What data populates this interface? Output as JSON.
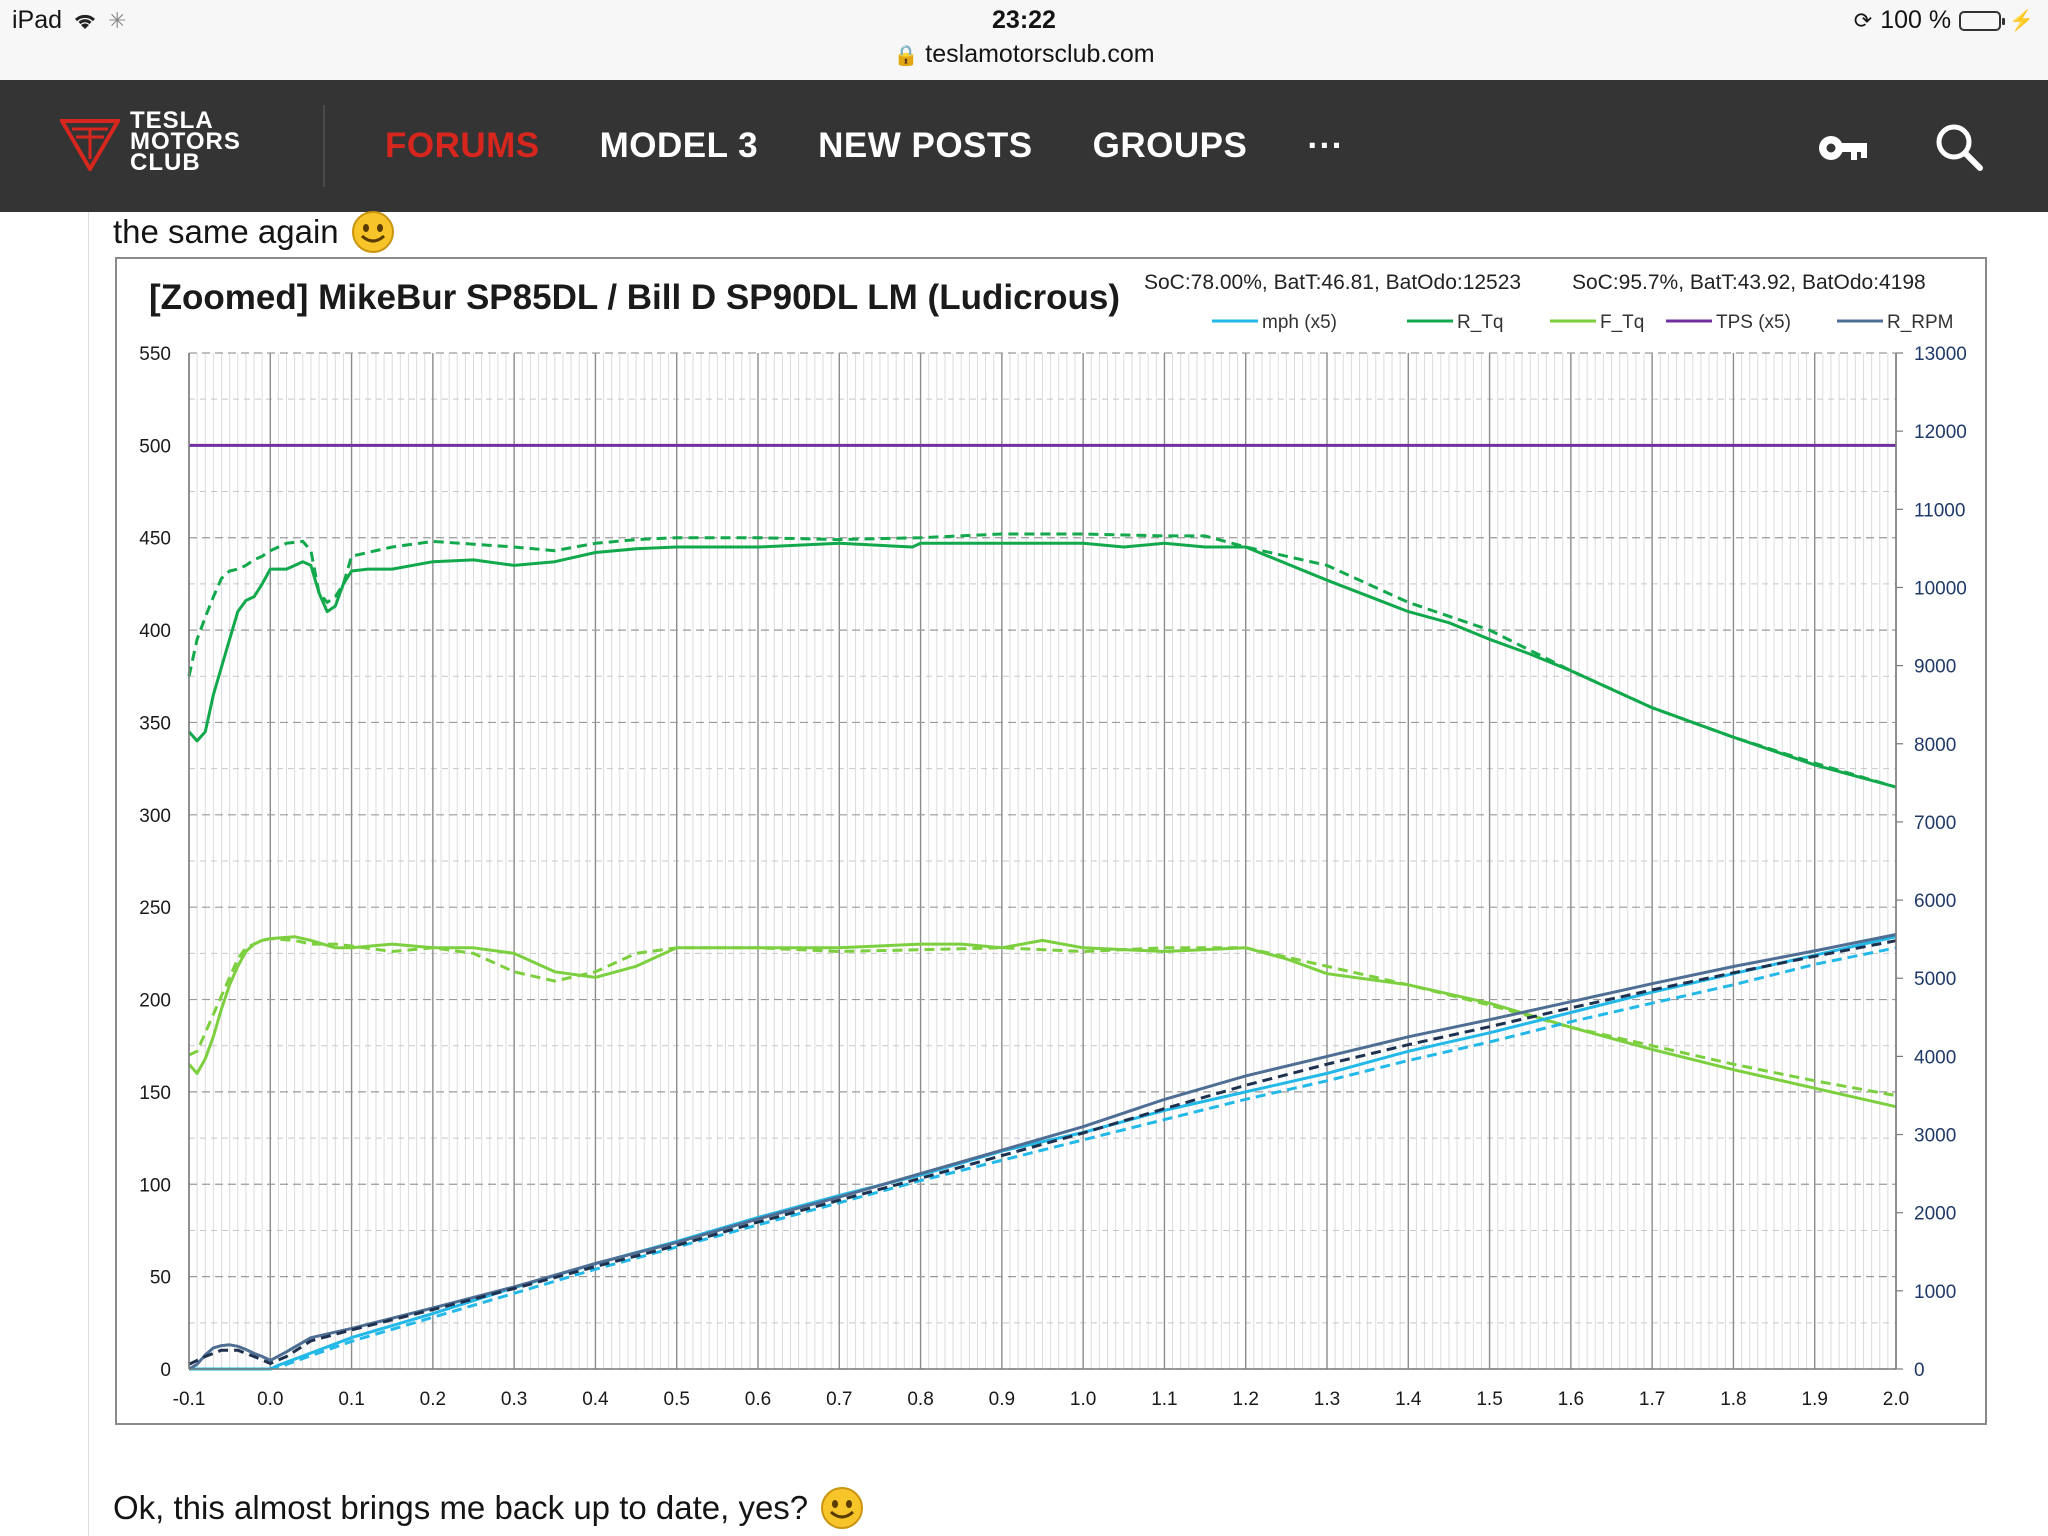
{
  "status_bar": {
    "device": "iPad",
    "time": "23:22",
    "url": "teslamotorsclub.com",
    "battery": "100 %"
  },
  "nav": {
    "logo_lines": [
      "TESLA",
      "MOTORS",
      "CLUB"
    ],
    "items": [
      {
        "label": "FORUMS",
        "active": true
      },
      {
        "label": "MODEL 3",
        "active": false
      },
      {
        "label": "NEW POSTS",
        "active": false
      },
      {
        "label": "GROUPS",
        "active": false
      },
      {
        "label": "···",
        "active": false
      }
    ],
    "accent_color": "#d7261e",
    "icons": [
      "key-icon",
      "search-icon"
    ]
  },
  "post": {
    "text_top": "the same again",
    "text_bottom": "Ok, this almost brings me back up to date, yes?",
    "emoji": "smiley-emoji"
  },
  "chart_data": {
    "type": "line",
    "title": "[Zoomed] MikeBur SP85DL / Bill D SP90DL LM (Ludicrous)",
    "subtitle_left": "SoC:78.00%, BatT:46.81, BatOdo:12523",
    "subtitle_right": "SoC:95.7%, BatT:43.92, BatOdo:4198",
    "xlim": [
      -0.1,
      2.0
    ],
    "x_ticks": [
      "-0.1",
      "0.0",
      "0.1",
      "0.2",
      "0.3",
      "0.4",
      "0.5",
      "0.6",
      "0.7",
      "0.8",
      "0.9",
      "1.0",
      "1.1",
      "1.2",
      "1.3",
      "1.4",
      "1.5",
      "1.6",
      "1.7",
      "1.8",
      "1.9",
      "2.0"
    ],
    "ylim_left": [
      0,
      550
    ],
    "y_ticks_left": [
      "0",
      "50",
      "100",
      "150",
      "200",
      "250",
      "300",
      "350",
      "400",
      "450",
      "500",
      "550"
    ],
    "ylim_right": [
      0,
      13000
    ],
    "y_ticks_right": [
      "0",
      "1000",
      "2000",
      "3000",
      "4000",
      "5000",
      "6000",
      "7000",
      "8000",
      "9000",
      "10000",
      "11000",
      "12000",
      "13000"
    ],
    "grid": true,
    "legend_position": "top-right",
    "legend": [
      {
        "name": "mph (x5)",
        "color": "#22b8e8"
      },
      {
        "name": "R_Tq",
        "color": "#12a84c"
      },
      {
        "name": "F_Tq",
        "color": "#7ccf3e"
      },
      {
        "name": "TPS (x5)",
        "color": "#7030a0"
      },
      {
        "name": "R_RPM",
        "color": "#4f6e94"
      }
    ],
    "series": [
      {
        "name": "TPS (x5)",
        "axis": "left",
        "color": "#7030a0",
        "style": "solid",
        "x": [
          -0.1,
          2.0
        ],
        "y": [
          500,
          500
        ]
      },
      {
        "name": "R_Tq",
        "axis": "left",
        "color": "#12a84c",
        "style": "solid",
        "x": [
          -0.1,
          -0.09,
          -0.08,
          -0.07,
          -0.06,
          -0.05,
          -0.04,
          -0.03,
          -0.02,
          -0.01,
          0.0,
          0.02,
          0.04,
          0.05,
          0.06,
          0.07,
          0.08,
          0.09,
          0.1,
          0.12,
          0.15,
          0.2,
          0.25,
          0.3,
          0.35,
          0.4,
          0.45,
          0.5,
          0.6,
          0.7,
          0.79,
          0.8,
          0.9,
          1.0,
          1.05,
          1.1,
          1.15,
          1.2,
          1.3,
          1.4,
          1.45,
          1.5,
          1.55,
          1.6,
          1.7,
          1.8,
          1.9,
          2.0
        ],
        "y": [
          345,
          340,
          345,
          365,
          380,
          395,
          410,
          416,
          418,
          425,
          433,
          433,
          437,
          435,
          420,
          410,
          413,
          425,
          432,
          433,
          433,
          437,
          438,
          435,
          437,
          442,
          444,
          445,
          445,
          447,
          445,
          447,
          447,
          447,
          445,
          447,
          445,
          445,
          427,
          410,
          404,
          395,
          387,
          378,
          358,
          342,
          327,
          315
        ]
      },
      {
        "name": "R_Tq",
        "axis": "left",
        "color": "#12a84c",
        "style": "dashed",
        "x": [
          -0.1,
          -0.09,
          -0.08,
          -0.07,
          -0.06,
          -0.05,
          -0.04,
          -0.03,
          -0.02,
          -0.01,
          0.0,
          0.02,
          0.04,
          0.05,
          0.06,
          0.07,
          0.08,
          0.09,
          0.1,
          0.12,
          0.15,
          0.2,
          0.3,
          0.35,
          0.4,
          0.45,
          0.5,
          0.6,
          0.7,
          0.8,
          0.9,
          1.0,
          1.1,
          1.15,
          1.2,
          1.3,
          1.4,
          1.5,
          1.6,
          1.7,
          1.8,
          1.9,
          2.0
        ],
        "y": [
          375,
          395,
          407,
          418,
          428,
          432,
          433,
          435,
          438,
          440,
          443,
          447,
          448,
          443,
          420,
          415,
          418,
          425,
          440,
          442,
          445,
          448,
          445,
          443,
          447,
          449,
          450,
          450,
          449,
          450,
          452,
          452,
          451,
          451,
          445,
          435,
          415,
          400,
          378,
          358,
          342,
          328,
          315
        ]
      },
      {
        "name": "F_Tq",
        "axis": "left",
        "color": "#7ccf3e",
        "style": "solid",
        "x": [
          -0.1,
          -0.09,
          -0.08,
          -0.07,
          -0.06,
          -0.05,
          -0.04,
          -0.03,
          -0.02,
          -0.01,
          0.0,
          0.03,
          0.05,
          0.08,
          0.1,
          0.15,
          0.2,
          0.25,
          0.3,
          0.35,
          0.4,
          0.45,
          0.5,
          0.6,
          0.7,
          0.8,
          0.85,
          0.9,
          0.95,
          1.0,
          1.1,
          1.2,
          1.25,
          1.3,
          1.4,
          1.5,
          1.6,
          1.7,
          1.8,
          1.9,
          2.0
        ],
        "y": [
          165,
          160,
          168,
          180,
          195,
          208,
          218,
          226,
          230,
          232,
          233,
          234,
          232,
          228,
          228,
          230,
          228,
          228,
          225,
          215,
          212,
          218,
          228,
          228,
          228,
          230,
          230,
          228,
          232,
          228,
          226,
          228,
          222,
          214,
          208,
          198,
          185,
          173,
          162,
          152,
          142
        ]
      },
      {
        "name": "F_Tq",
        "axis": "left",
        "color": "#7ccf3e",
        "style": "dashed",
        "x": [
          -0.1,
          -0.09,
          -0.08,
          -0.07,
          -0.06,
          -0.05,
          -0.04,
          -0.03,
          -0.02,
          -0.01,
          0.0,
          0.03,
          0.05,
          0.08,
          0.1,
          0.15,
          0.2,
          0.25,
          0.3,
          0.35,
          0.4,
          0.45,
          0.5,
          0.6,
          0.7,
          0.8,
          0.9,
          1.0,
          1.1,
          1.2,
          1.3,
          1.4,
          1.5,
          1.6,
          1.7,
          1.8,
          1.9,
          2.0
        ],
        "y": [
          170,
          172,
          182,
          192,
          202,
          212,
          222,
          228,
          230,
          232,
          233,
          232,
          230,
          230,
          229,
          226,
          228,
          225,
          215,
          210,
          215,
          225,
          228,
          228,
          226,
          227,
          228,
          226,
          228,
          228,
          218,
          208,
          197,
          185,
          175,
          165,
          156,
          148
        ]
      },
      {
        "name": "mph (x5)",
        "axis": "left",
        "color": "#22b8e8",
        "style": "solid",
        "x": [
          -0.1,
          0.0,
          0.01,
          0.1,
          0.2,
          0.3,
          0.4,
          0.5,
          0.6,
          0.7,
          0.8,
          0.9,
          1.0,
          1.1,
          1.2,
          1.3,
          1.4,
          1.5,
          1.6,
          1.7,
          1.8,
          1.9,
          2.0
        ],
        "y": [
          0,
          0,
          2,
          17,
          30,
          44,
          57,
          69,
          82,
          94,
          105,
          118,
          128,
          140,
          150,
          160,
          172,
          182,
          193,
          204,
          214,
          224,
          234
        ]
      },
      {
        "name": "mph (x5)",
        "axis": "left",
        "color": "#22b8e8",
        "style": "dashed",
        "x": [
          -0.1,
          0.0,
          0.01,
          0.1,
          0.2,
          0.3,
          0.4,
          0.5,
          0.6,
          0.7,
          0.8,
          0.9,
          1.0,
          1.1,
          1.2,
          1.3,
          1.4,
          1.5,
          1.6,
          1.7,
          1.8,
          1.9,
          2.0
        ],
        "y": [
          0,
          0,
          1,
          15,
          28,
          41,
          54,
          66,
          78,
          90,
          102,
          113,
          124,
          135,
          146,
          156,
          167,
          177,
          188,
          198,
          208,
          219,
          228
        ]
      },
      {
        "name": "R_RPM",
        "axis": "right",
        "color": "#4f6e94",
        "style": "solid",
        "x": [
          -0.1,
          -0.09,
          -0.08,
          -0.07,
          -0.06,
          -0.05,
          -0.04,
          -0.03,
          -0.02,
          -0.01,
          0.0,
          0.02,
          0.05,
          0.1,
          0.2,
          0.3,
          0.4,
          0.5,
          0.6,
          0.7,
          0.8,
          0.9,
          1.0,
          1.1,
          1.2,
          1.3,
          1.4,
          1.5,
          1.6,
          1.7,
          1.8,
          1.9,
          2.0
        ],
        "y": [
          0,
          60,
          180,
          270,
          300,
          310,
          290,
          250,
          200,
          160,
          110,
          220,
          400,
          520,
          780,
          1050,
          1350,
          1620,
          1920,
          2200,
          2500,
          2800,
          3100,
          3450,
          3750,
          4000,
          4250,
          4470,
          4700,
          4930,
          5150,
          5350,
          5560
        ]
      },
      {
        "name": "R_RPM",
        "axis": "right",
        "color": "#1e3250",
        "style": "dashed",
        "x": [
          -0.1,
          -0.08,
          -0.06,
          -0.04,
          -0.02,
          0.0,
          0.02,
          0.05,
          0.1,
          0.2,
          0.3,
          0.4,
          0.5,
          0.6,
          0.7,
          0.8,
          0.9,
          1.0,
          1.1,
          1.2,
          1.3,
          1.4,
          1.5,
          1.6,
          1.7,
          1.8,
          1.9,
          2.0
        ],
        "y": [
          60,
          160,
          240,
          240,
          160,
          70,
          160,
          360,
          500,
          760,
          1030,
          1310,
          1580,
          1880,
          2160,
          2440,
          2730,
          3020,
          3330,
          3630,
          3900,
          4150,
          4380,
          4620,
          4850,
          5070,
          5280,
          5480
        ]
      }
    ]
  }
}
